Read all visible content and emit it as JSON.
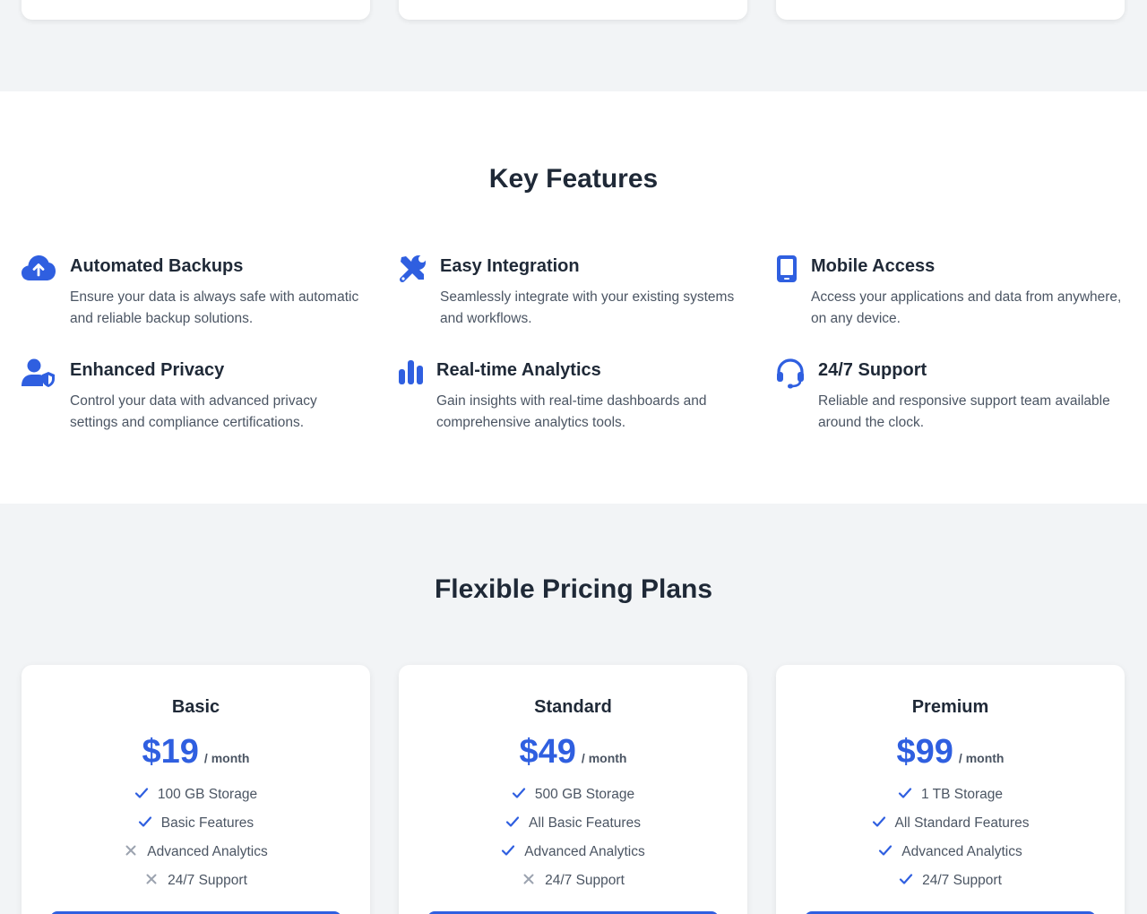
{
  "features": {
    "title": "Key Features",
    "items": [
      {
        "icon": "cloud-upload-icon",
        "title": "Automated Backups",
        "desc_lines": [
          "Ensure your data is always safe with automatic",
          "and reliable backup solutions."
        ]
      },
      {
        "icon": "tools-icon",
        "title": "Easy Integration",
        "desc_lines": [
          "Seamlessly integrate with your existing systems",
          "and workflows."
        ]
      },
      {
        "icon": "mobile-icon",
        "title": "Mobile Access",
        "desc_lines": [
          "Access your applications and data from anywhere,",
          "on any device."
        ]
      },
      {
        "icon": "user-shield-icon",
        "title": "Enhanced Privacy",
        "desc_lines": [
          "Control your data with advanced privacy",
          "settings and compliance certifications."
        ]
      },
      {
        "icon": "bar-chart-icon",
        "title": "Real-time Analytics",
        "desc_lines": [
          "Gain insights with real-time dashboards and",
          "comprehensive analytics tools."
        ]
      },
      {
        "icon": "headset-icon",
        "title": "24/7 Support",
        "desc_lines": [
          "Reliable and responsive support team available",
          "around the clock."
        ]
      }
    ]
  },
  "pricing": {
    "title": "Flexible Pricing Plans",
    "plans": [
      {
        "name": "Basic",
        "price": "$19",
        "period": "/ month",
        "features": [
          {
            "label": "100 GB Storage",
            "included": true
          },
          {
            "label": "Basic Features",
            "included": true
          },
          {
            "label": "Advanced Analytics",
            "included": false
          },
          {
            "label": "24/7 Support",
            "included": false
          }
        ]
      },
      {
        "name": "Standard",
        "price": "$49",
        "period": "/ month",
        "features": [
          {
            "label": "500 GB Storage",
            "included": true
          },
          {
            "label": "All Basic Features",
            "included": true
          },
          {
            "label": "Advanced Analytics",
            "included": true
          },
          {
            "label": "24/7 Support",
            "included": false
          }
        ]
      },
      {
        "name": "Premium",
        "price": "$99",
        "period": "/ month",
        "features": [
          {
            "label": "1 TB Storage",
            "included": true
          },
          {
            "label": "All Standard Features",
            "included": true
          },
          {
            "label": "Advanced Analytics",
            "included": true
          },
          {
            "label": "24/7 Support",
            "included": true
          }
        ]
      }
    ]
  },
  "colors": {
    "accent": "#2f5fe0",
    "heading": "#1f2937",
    "body_text": "#4b5563",
    "muted_mark": "#9ca3af",
    "section_bg": "#f2f4f6"
  }
}
